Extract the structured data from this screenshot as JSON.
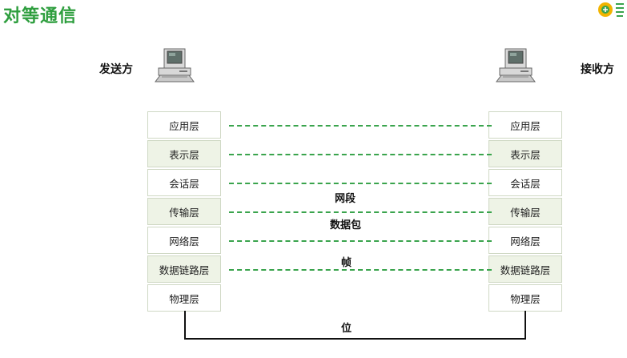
{
  "title": "对等通信",
  "sender": {
    "label": "发送方",
    "icon": "computer-icon"
  },
  "receiver": {
    "label": "接收方",
    "icon": "computer-icon"
  },
  "layers": [
    "应用层",
    "表示层",
    "会话层",
    "传输层",
    "网络层",
    "数据链路层",
    "物理层"
  ],
  "data_units": {
    "transport": "网段",
    "network": "数据包",
    "datalink": "帧",
    "physical": "位"
  },
  "colors": {
    "title": "#2e9e3e",
    "dash": "#3aa44d",
    "layer_alt": "#eef3e6"
  }
}
